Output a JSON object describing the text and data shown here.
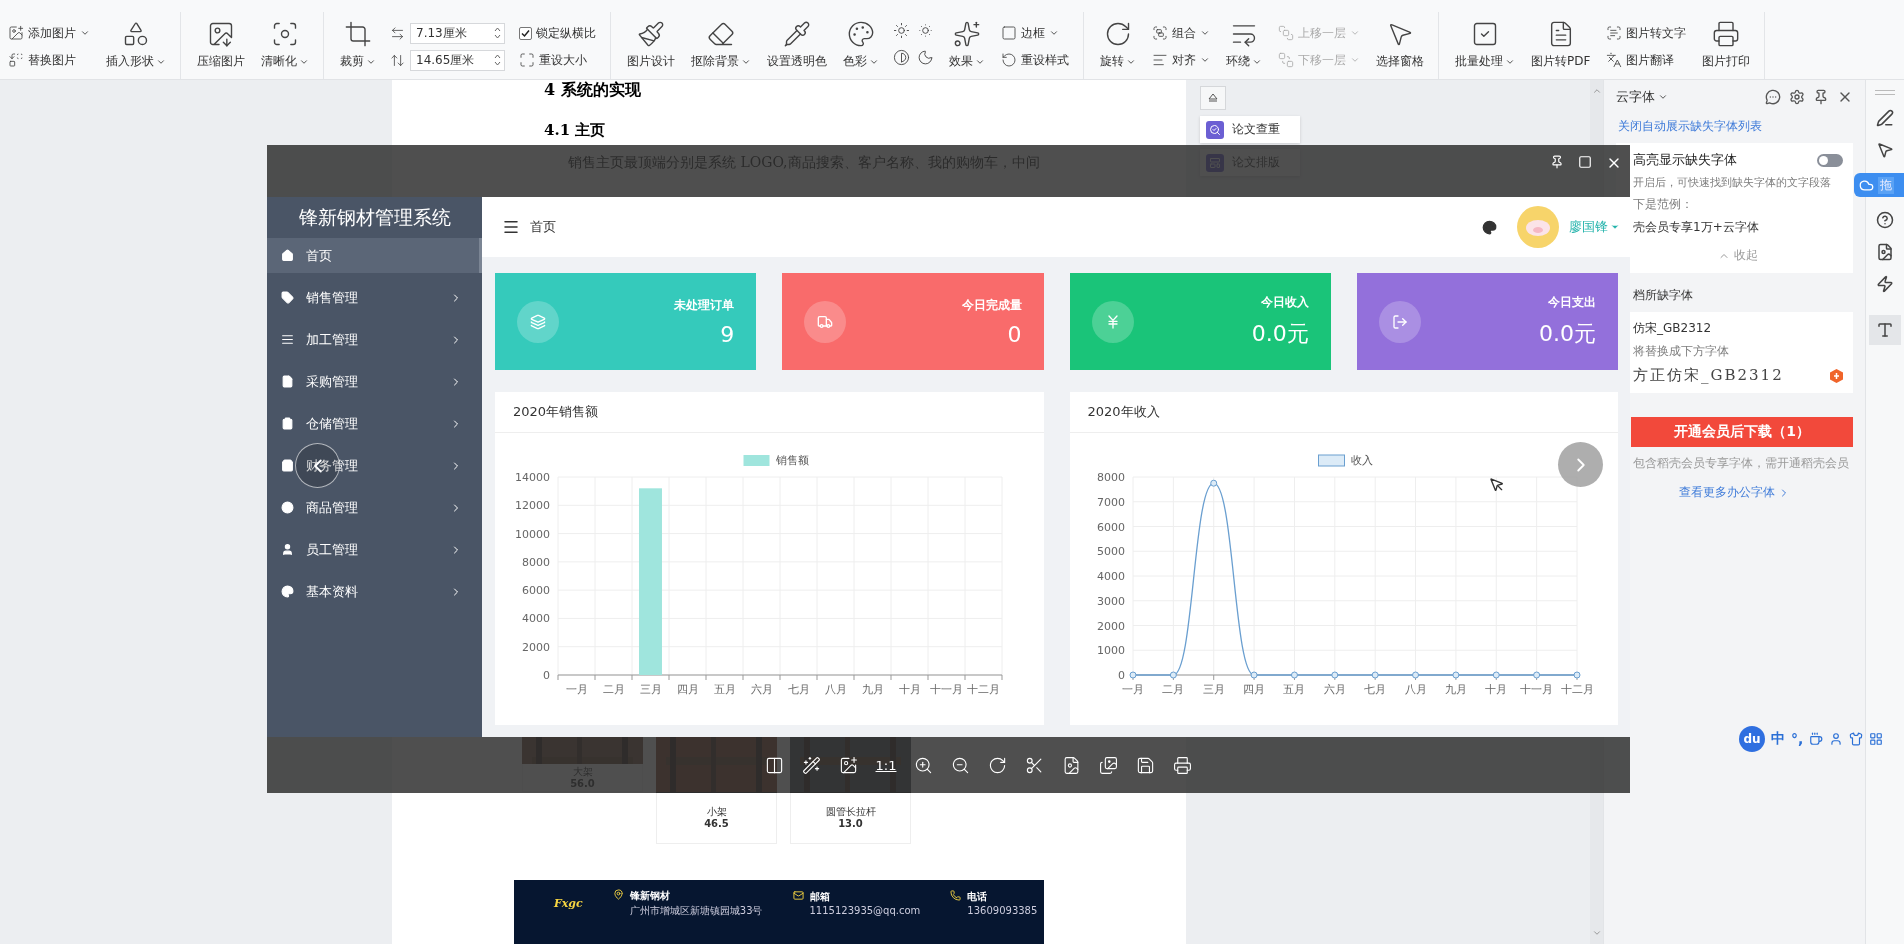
{
  "ribbon": [
    [
      {
        "kind": "stack",
        "items": [
          {
            "kind": "button",
            "label": "添加图片",
            "dropdown": true,
            "disabled": false
          },
          {
            "kind": "button",
            "label": "替换图片",
            "dropdown": false,
            "disabled": false
          }
        ]
      },
      {
        "kind": "large",
        "label": "插入形状",
        "dropdown": true
      }
    ],
    [
      {
        "kind": "large",
        "label": "压缩图片",
        "dropdown": false
      },
      {
        "kind": "large",
        "label": "清晰化",
        "dropdown": true
      }
    ],
    [
      {
        "kind": "large",
        "label": "裁剪",
        "dropdown": true
      },
      {
        "kind": "size",
        "fields": [
          {
            "value": "7.13厘米"
          },
          {
            "value": "14.65厘米"
          }
        ]
      },
      {
        "kind": "stack",
        "items": [
          {
            "kind": "check",
            "label": "锁定纵横比",
            "checked": true,
            "dropdown": false,
            "disabled": false
          },
          {
            "kind": "button",
            "label": "重设大小",
            "dropdown": false,
            "disabled": false
          }
        ]
      }
    ],
    [
      {
        "kind": "large",
        "label": "图片设计",
        "dropdown": false
      },
      {
        "kind": "large",
        "label": "抠除背景",
        "dropdown": true
      },
      {
        "kind": "large",
        "label": "设置透明色",
        "dropdown": false
      },
      {
        "kind": "large",
        "label": "色彩",
        "dropdown": true
      },
      {
        "kind": "icon-grid"
      },
      {
        "kind": "large",
        "label": "效果",
        "dropdown": true
      },
      {
        "kind": "stack",
        "items": [
          {
            "kind": "button",
            "label": "边框",
            "dropdown": true,
            "disabled": false
          },
          {
            "kind": "button",
            "label": "重设样式",
            "dropdown": false,
            "disabled": false
          }
        ]
      }
    ],
    [
      {
        "kind": "large",
        "label": "旋转",
        "dropdown": true
      },
      {
        "kind": "stack",
        "items": [
          {
            "kind": "button",
            "label": "组合",
            "dropdown": true,
            "disabled": false
          },
          {
            "kind": "button",
            "label": "对齐",
            "dropdown": true,
            "disabled": false
          }
        ]
      },
      {
        "kind": "large",
        "label": "环绕",
        "dropdown": true
      },
      {
        "kind": "stack",
        "items": [
          {
            "kind": "button",
            "label": "上移一层",
            "dropdown": true,
            "disabled": true
          },
          {
            "kind": "button",
            "label": "下移一层",
            "dropdown": true,
            "disabled": true
          }
        ]
      },
      {
        "kind": "large",
        "label": "选择窗格",
        "dropdown": false
      }
    ],
    [
      {
        "kind": "large",
        "label": "批量处理",
        "dropdown": true
      },
      {
        "kind": "large",
        "label": "图片转PDF",
        "dropdown": false
      },
      {
        "kind": "stack",
        "items": [
          {
            "kind": "button",
            "label": "图片转文字",
            "dropdown": false,
            "disabled": false
          },
          {
            "kind": "button",
            "label": "图片翻译",
            "dropdown": false,
            "disabled": false
          }
        ]
      },
      {
        "kind": "large",
        "label": "图片打印",
        "dropdown": false
      }
    ]
  ],
  "doc": {
    "heading": "4  系统的实现",
    "subheading": "4.1  主页",
    "paragraph": "销售主页最顶端分别是系统 LOGO,商品搜索、客户名称、我的购物车，中间",
    "products": [
      {
        "name": "大架",
        "price": "56.0"
      },
      {
        "name": "小架",
        "price": "46.5"
      },
      {
        "name": "圆管长拉杆",
        "price": "13.0"
      }
    ],
    "footer": {
      "logo": "Fxgc",
      "contacts": [
        {
          "title": "锋新钢材",
          "detail": "广州市增城区新塘镇园城33号"
        },
        {
          "title": "邮箱",
          "detail": "1115123935@qq.com"
        },
        {
          "title": "电话",
          "detail": "13609093385"
        }
      ]
    }
  },
  "doc_tools": [
    "论文查重",
    "论文排版"
  ],
  "viewer": {
    "ratio_label": "1:1",
    "webapp": {
      "title": "锋新钢材管理系统",
      "breadcrumb": "首页",
      "user": "廖国锋",
      "menu": [
        {
          "label": "首页",
          "selected": true,
          "has_children": false
        },
        {
          "label": "销售管理",
          "selected": false,
          "has_children": true
        },
        {
          "label": "加工管理",
          "selected": false,
          "has_children": true
        },
        {
          "label": "采购管理",
          "selected": false,
          "has_children": true
        },
        {
          "label": "仓储管理",
          "selected": false,
          "has_children": true
        },
        {
          "label": "财务管理",
          "selected": false,
          "has_children": true
        },
        {
          "label": "商品管理",
          "selected": false,
          "has_children": true
        },
        {
          "label": "员工管理",
          "selected": false,
          "has_children": true
        },
        {
          "label": "基本资料",
          "selected": false,
          "has_children": true
        }
      ],
      "stats": [
        {
          "label": "未处理订单",
          "value": "9",
          "color": "#35cabb"
        },
        {
          "label": "今日完成量",
          "value": "0",
          "color": "#f96b6b"
        },
        {
          "label": "今日收入",
          "value": "0.0元",
          "color": "#1ac479"
        },
        {
          "label": "今日支出",
          "value": "0.0元",
          "color": "#9370db"
        }
      ],
      "charts": [
        {
          "title": "2020年销售额",
          "chart_data": {
            "type": "bar",
            "categories": [
              "一月",
              "二月",
              "三月",
              "四月",
              "五月",
              "六月",
              "七月",
              "八月",
              "九月",
              "十月",
              "十一月",
              "十二月"
            ],
            "ylim": [
              0,
              14000
            ],
            "yticks": [
              0,
              2000,
              4000,
              6000,
              8000,
              10000,
              12000,
              14000
            ],
            "grid": true,
            "series": [
              {
                "name": "销售额",
                "color": "#9fe5dd",
                "values": [
                  0,
                  0,
                  13200,
                  0,
                  0,
                  0,
                  0,
                  0,
                  0,
                  0,
                  0,
                  0
                ]
              }
            ]
          }
        },
        {
          "title": "2020年收入",
          "chart_data": {
            "type": "line",
            "categories": [
              "一月",
              "二月",
              "三月",
              "四月",
              "五月",
              "六月",
              "七月",
              "八月",
              "九月",
              "十月",
              "十一月",
              "十二月"
            ],
            "ylim": [
              0,
              8000
            ],
            "yticks": [
              0,
              1000,
              2000,
              3000,
              4000,
              5000,
              6000,
              7000,
              8000
            ],
            "grid": true,
            "series": [
              {
                "name": "收入",
                "color": "#6a9fd0",
                "marker": true,
                "values": [
                  0,
                  0,
                  7750,
                  0,
                  0,
                  0,
                  0,
                  0,
                  0,
                  0,
                  0,
                  0
                ]
              }
            ]
          }
        }
      ]
    }
  },
  "panel": {
    "title": "云字体",
    "link": "关闭自动展示缺失字体列表",
    "highlight_label": "高亮显示缺失字体",
    "highlight_on": false,
    "hint": "开启后，可快速找到缺失字体的文字段落",
    "example_label": "下是范例：",
    "example": "壳会员专享1万+云字体",
    "collapse": "收起",
    "missing_title": "档所缺字体",
    "font_name": "仿宋_GB2312",
    "font_note": "将替换成下方字体",
    "replacement": "方正仿宋_GB2312",
    "download": "开通会员后下载（1）",
    "warning": "包含稻壳会员专享字体，需开通稻壳会员",
    "more": "查看更多办公字体"
  },
  "side_tab": "拖",
  "ime": {
    "logo": "du",
    "chars": [
      "中",
      "°,"
    ]
  }
}
